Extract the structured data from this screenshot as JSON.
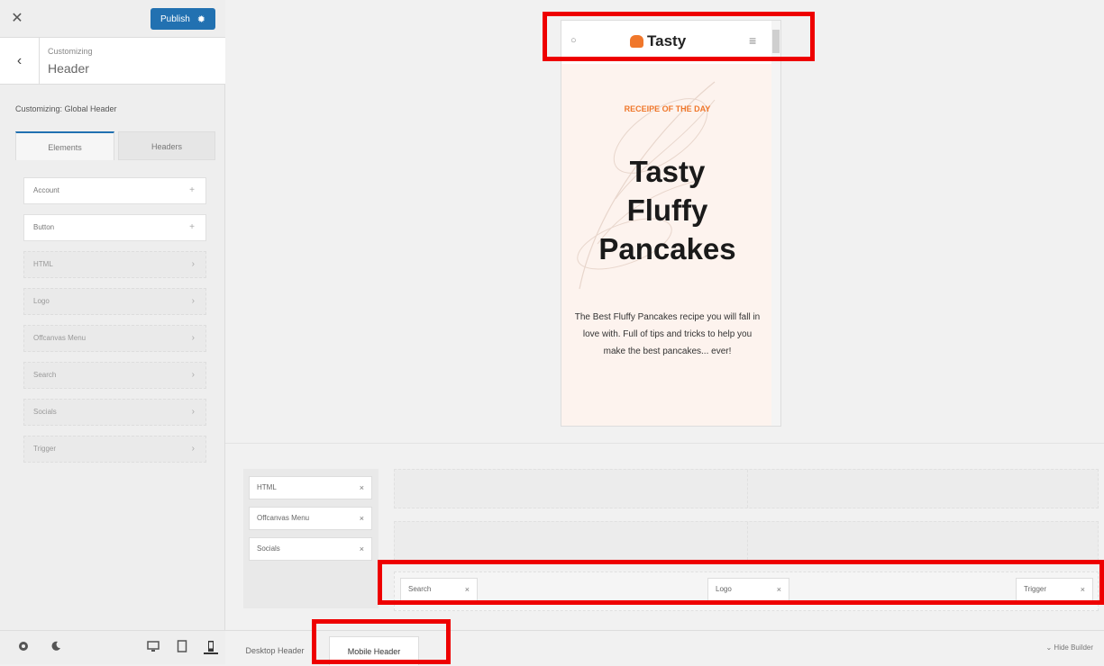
{
  "sidebar": {
    "close_symbol": "✕",
    "publish_label": "Publish",
    "publish_gear": "✹",
    "back_symbol": "‹",
    "crumb_small": "Customizing",
    "crumb_title": "Header",
    "section_title": "Customizing: Global Header",
    "tabs": [
      {
        "label": "Elements"
      },
      {
        "label": "Headers"
      }
    ],
    "elements": [
      {
        "label": "Account",
        "symbol": "+"
      },
      {
        "label": "Button",
        "symbol": "+"
      },
      {
        "label": "HTML",
        "symbol": "›"
      },
      {
        "label": "Logo",
        "symbol": "›"
      },
      {
        "label": "Offcanvas Menu",
        "symbol": "›"
      },
      {
        "label": "Search",
        "symbol": "›"
      },
      {
        "label": "Socials",
        "symbol": "›"
      },
      {
        "label": "Trigger",
        "symbol": "›"
      }
    ]
  },
  "preview": {
    "logo_text": "Tasty",
    "search_symbol": "○",
    "menu_symbol": "≡",
    "recipe_label": "RECEIPE OF THE DAY",
    "hero_title_1": "Tasty",
    "hero_title_2": "Fluffy",
    "hero_title_3": "Pancakes",
    "hero_text": "The Best Fluffy Pancakes recipe you will fall in love with. Full of tips and tricks to help you make the best pancakes... ever!"
  },
  "builder": {
    "available": [
      "HTML",
      "Offcanvas Menu",
      "Socials"
    ],
    "bottom_row": {
      "left": "Search",
      "center": "Logo",
      "right": "Trigger"
    },
    "remove_symbol": "×",
    "tabs": {
      "desktop": "Desktop Header",
      "mobile": "Mobile Header"
    },
    "hide_builder": "Hide Builder"
  },
  "colors": {
    "accent": "#2271b1",
    "brand_orange": "#f0772b",
    "highlight_red": "#ee0000"
  }
}
